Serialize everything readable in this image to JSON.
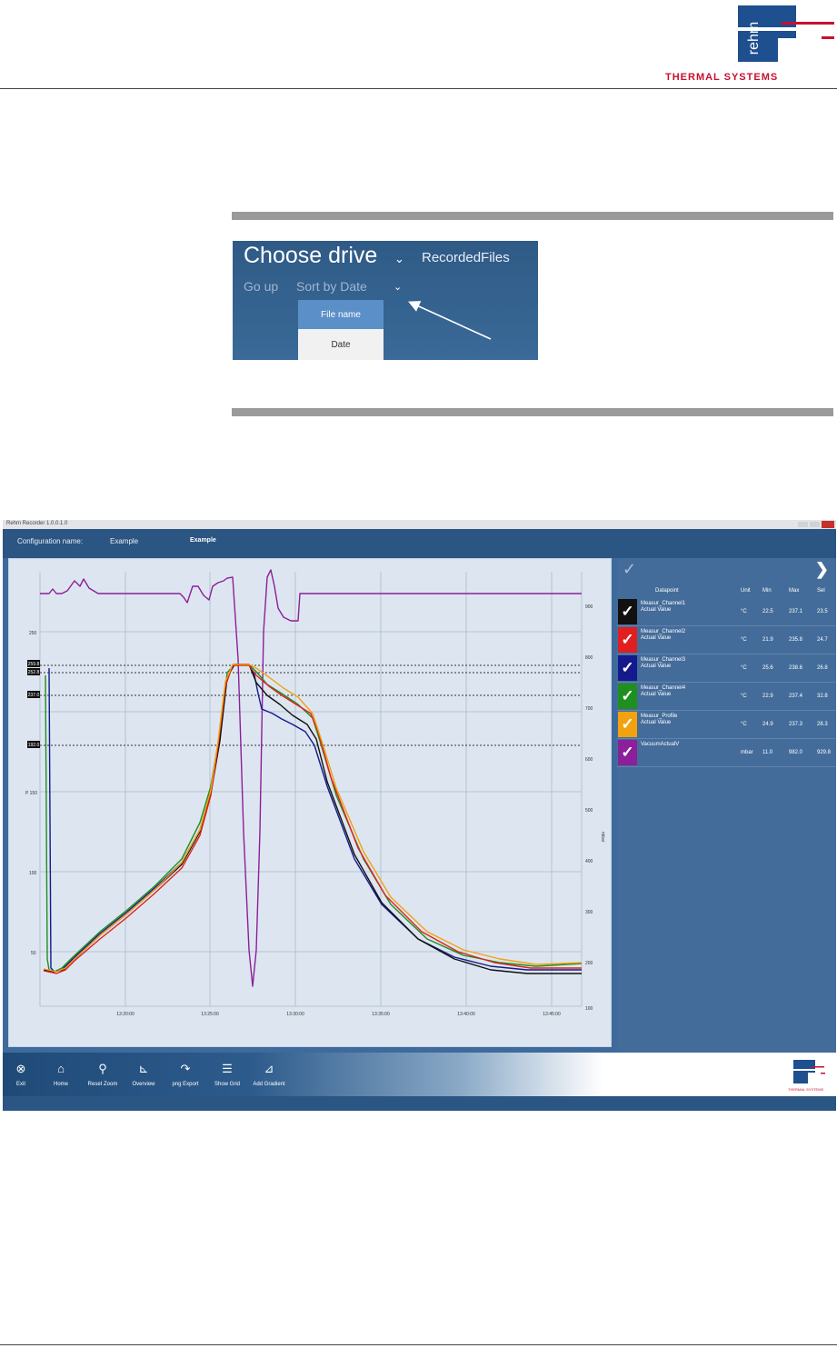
{
  "header": {
    "logo_text": "THERMAL SYSTEMS",
    "brand_colors": {
      "blue": "#1e4f8f",
      "red": "#c8102e"
    }
  },
  "drive_picker": {
    "choose_drive": "Choose drive",
    "chevron_icon": "chevron-down-icon",
    "recorded_files": "RecordedFiles",
    "go_up": "Go up",
    "sort_by": "Sort by Date",
    "options": [
      "File name",
      "Date"
    ],
    "highlighted_option": "File name"
  },
  "app": {
    "window_title": "Rehm Recorder  1.0.0.1.0",
    "config_label": "Configuration name:",
    "config_value": "Example",
    "config_extra": "Example",
    "chart": {
      "left_ticks": [
        "250",
        "",
        "P 150",
        "100",
        "50"
      ],
      "right_ticks": [
        "900",
        "800",
        "700",
        "600",
        "500",
        "400",
        "300",
        "200",
        "100"
      ],
      "right_axis_label": "mbar",
      "x_ticks": [
        "13:20:00",
        "13:25:00",
        "13:30:00",
        "13:35:00",
        "13:40:00",
        "13:45:00"
      ],
      "markers": [
        "259.8",
        "252.8",
        "237.0",
        "192.0"
      ]
    },
    "datapoints": {
      "headers": {
        "datapoint": "Datapoint",
        "unit": "Unit",
        "min": "Min",
        "max": "Max",
        "sel": "Sel"
      },
      "rows": [
        {
          "name": "Measur_Channel1",
          "sub": "Actual Value",
          "unit": "°C",
          "min": "22.5",
          "max": "237.1",
          "sel": "23.5",
          "color": "#111111"
        },
        {
          "name": "Measur_Channel2",
          "sub": "Actual Value",
          "unit": "°C",
          "min": "21.9",
          "max": "235.8",
          "sel": "24.7",
          "color": "#e02020"
        },
        {
          "name": "Measur_Channel3",
          "sub": "Actual Value",
          "unit": "°C",
          "min": "25.6",
          "max": "238.6",
          "sel": "26.8",
          "color": "#141a8c"
        },
        {
          "name": "Measur_Channel4",
          "sub": "Actual Value",
          "unit": "°C",
          "min": "22.9",
          "max": "237.4",
          "sel": "32.8",
          "color": "#1f8f1f"
        },
        {
          "name": "Measur_Profile",
          "sub": "Actual Value",
          "unit": "°C",
          "min": "24.9",
          "max": "237.3",
          "sel": "28.3",
          "color": "#f2a20f"
        },
        {
          "name": "VacuumActualV",
          "sub": "",
          "unit": "mbar",
          "min": "11.0",
          "max": "982.0",
          "sel": "929.8",
          "color": "#8c1f9a"
        }
      ]
    },
    "toolbar": [
      {
        "label": "Exit",
        "icon": "exit-icon"
      },
      {
        "label": "Home",
        "icon": "home-icon"
      },
      {
        "label": "Reset Zoom",
        "icon": "reset-zoom-icon"
      },
      {
        "label": "Overview",
        "icon": "overview-icon"
      },
      {
        "label": "png Export",
        "icon": "export-icon"
      },
      {
        "label": "Show Grid",
        "icon": "grid-icon"
      },
      {
        "label": "Add Gradient",
        "icon": "gradient-icon"
      }
    ],
    "toolbar_logo_text": "THERMAL SYSTEMS"
  }
}
